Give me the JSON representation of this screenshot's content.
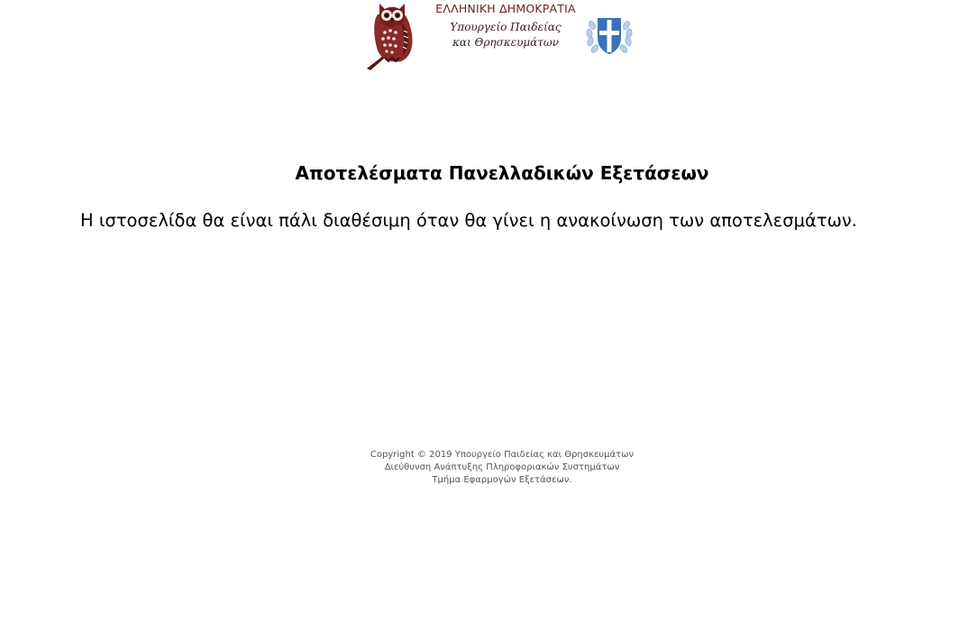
{
  "header": {
    "government_name": "ΕΛΛΗΝΙΚΗ ΔΗΜΟΚΡΑΤΙΑ",
    "ministry_line1": "Υπουργείο Παιδείας",
    "ministry_line2": "και Θρησκευμάτων",
    "owl_icon": "owl-logo-icon",
    "emblem_icon": "greek-coat-of-arms-icon"
  },
  "main": {
    "title": "Αποτελέσματα Πανελλαδικών Εξετάσεων",
    "message": "Η ιστοσελίδα θα είναι πάλι διαθέσιμη όταν θα γίνει η ανακοίνωση των αποτελεσμάτων."
  },
  "footer": {
    "copyright": "Copyright © 2019 Υπουργείο Παιδείας και Θρησκευμάτων",
    "directorate": "Διεύθυνση Ανάπτυξης Πληροφοριακών Συστημάτων",
    "department": "Τμήμα Εφαρμογών Εξετάσεων."
  },
  "colors": {
    "logo_dark_red": "#7a1f1f",
    "emblem_blue": "#3a72b8",
    "footer_text": "#555555"
  }
}
